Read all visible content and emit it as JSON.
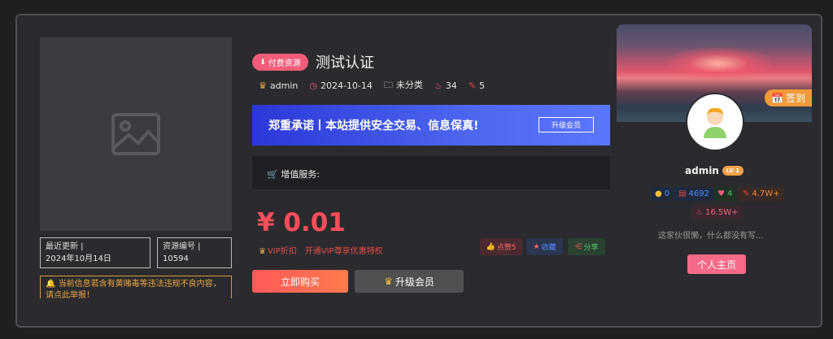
{
  "post": {
    "pay_badge": "付费资源",
    "title": "测试认证",
    "meta": {
      "author": "admin",
      "date": "2024-10-14",
      "category": "未分类",
      "views": "34",
      "comments": "5"
    }
  },
  "left": {
    "updated_label": "最近更新",
    "updated_value": "2024年10月14日",
    "id_label": "资源编号",
    "id_value": "10594",
    "notice": "当前信息若含有黄赌毒等违法违规不良内容，请点此举报！"
  },
  "banner": {
    "text": "郑重承诺丨本站提供安全交易、信息保真!",
    "button": "升级会员"
  },
  "service": {
    "label": "增值服务:"
  },
  "price": {
    "value": "¥ 0.01",
    "vip_label": "VIP折扣",
    "vip_promo": "开通VIP尊享优惠特权"
  },
  "actions": {
    "like": "点赞5",
    "fav": "收藏",
    "share": "分享",
    "buy": "立即购买",
    "upgrade": "升级会员"
  },
  "user": {
    "checkin": "签到",
    "name": "admin",
    "level": "LV 1",
    "stats": {
      "s1": "0",
      "s2": "4692",
      "s3": "4",
      "s4": "4.7W+",
      "s5": "16.5W+"
    },
    "bio": "这家伙很懒，什么都没有写...",
    "home_button": "个人主页"
  },
  "colors": {
    "accent": "#f35d7a",
    "price": "#ff4d5a",
    "banner": "#3a4de6",
    "checkin": "#f09a3a"
  }
}
